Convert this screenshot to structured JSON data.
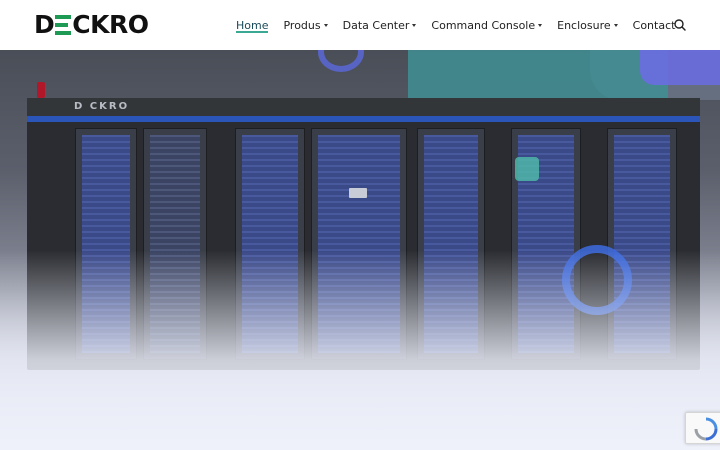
{
  "brand": {
    "logo_text_left": "D",
    "logo_text_right": "CKRO",
    "server_brand": "D CKRO"
  },
  "nav": {
    "items": [
      {
        "label": "Home",
        "active": true,
        "has_dropdown": false
      },
      {
        "label": "Produs",
        "active": false,
        "has_dropdown": true
      },
      {
        "label": "Data Center",
        "active": false,
        "has_dropdown": true
      },
      {
        "label": "Command Console",
        "active": false,
        "has_dropdown": true
      },
      {
        "label": "Enclosure",
        "active": false,
        "has_dropdown": true
      },
      {
        "label": "Contact",
        "active": false,
        "has_dropdown": false
      }
    ],
    "search_icon": "search-icon"
  },
  "colors": {
    "accent": "#3aa893",
    "logo_green": "#1e9a55",
    "hero_blue": "#2c55b9"
  },
  "hero": {
    "image": "modular data center server cabinets"
  },
  "recaptcha": {
    "icon": "recaptcha-icon"
  }
}
